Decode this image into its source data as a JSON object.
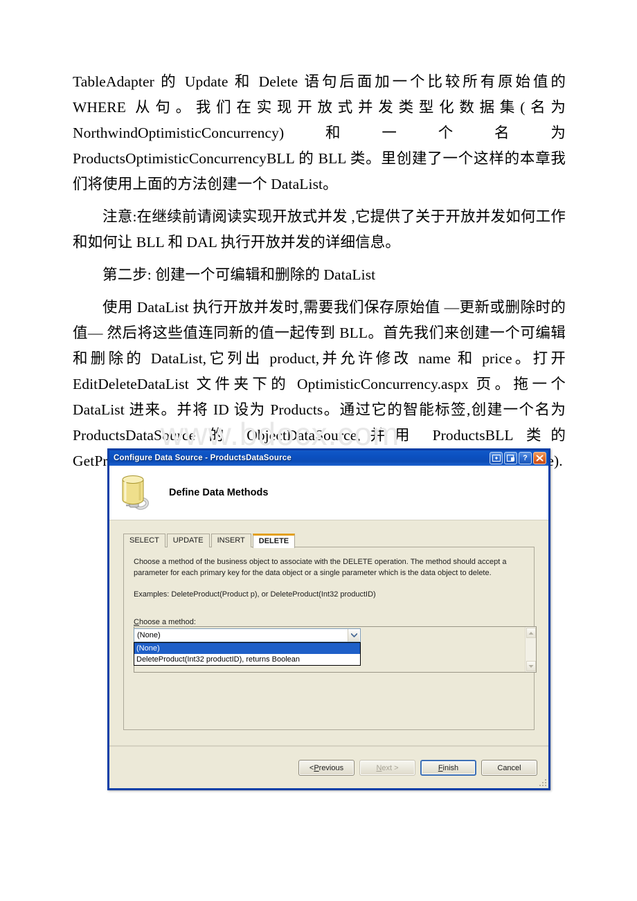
{
  "document": {
    "paragraphs": [
      "TableAdapter 的 Update 和 Delete 语句后面加一个比较所有原始值的 WHERE 从句。我们在实现开放式并发类型化数据集(名为 NorthwindOptimisticConcurrency)和一个名为 ProductsOptimisticConcurrencyBLL 的 BLL 类。里创建了一个这样的本章我们将使用上面的方法创建一个 DataList。",
      "注意:在继续前请阅读实现开放式并发 ,它提供了关于开放并发如何工作和如何让 BLL 和 DAL 执行开放并发的详细信息。",
      "第二步: 创建一个可编辑和删除的 DataList",
      "使用 DataList 执行开放并发时,需要我们保存原始值 —更新或删除时的值— 然后将这些值连同新的值一起传到 BLL。首先我们来创建一个可编辑和删除的 DataList,它列出 product,并允许修改 name 和 price。打开 EditDeleteDataList 文件夹下的 OptimisticConcurrency.aspx 页。拖一个 DataList 进来。并将 ID 设为 Products。通过它的智能标签,创建一个名为 ProductsDataSource 的 ObjectDataSource,并用 ProductsBLL 类的 GetProducts()方法配置它。在 UPDATE,INSERT,DELETE 标签里选择(None)."
    ],
    "watermark": "www.bdocx.com"
  },
  "dialog": {
    "title": "Configure Data Source - ProductsDataSource",
    "titlebar_buttons": [
      {
        "name": "restore-split-button",
        "glyph": "◂▸"
      },
      {
        "name": "maximize-button",
        "glyph": "❐"
      },
      {
        "name": "help-button",
        "glyph": "?"
      },
      {
        "name": "close-button",
        "glyph": "✕"
      }
    ],
    "header_title": "Define Data Methods",
    "icon": "database-plug-icon",
    "tabs": [
      {
        "label": "SELECT",
        "active": false
      },
      {
        "label": "UPDATE",
        "active": false
      },
      {
        "label": "INSERT",
        "active": false
      },
      {
        "label": "DELETE",
        "active": true
      }
    ],
    "panel": {
      "description": "Choose a method of the business object to associate with the DELETE operation. The method should accept a parameter for each primary key for the data object or a single parameter which is the data object to delete.",
      "examples": "Examples: DeleteProduct(Product p), or DeleteProduct(Int32 productID)",
      "choose_label_prefix": "C",
      "choose_label_rest": "hoose a method:",
      "combo_value": "(None)",
      "dropdown_options": [
        {
          "label": "(None)",
          "selected": true
        },
        {
          "label": "DeleteProduct(Int32 productID), returns Boolean",
          "selected": false
        }
      ]
    },
    "buttons": [
      {
        "name": "previous-button",
        "pre": "< ",
        "accel": "P",
        "post": "revious",
        "state": "enabled"
      },
      {
        "name": "next-button",
        "pre": "",
        "accel": "N",
        "post": "ext >",
        "state": "disabled"
      },
      {
        "name": "finish-button",
        "pre": "",
        "accel": "F",
        "post": "inish",
        "state": "default"
      },
      {
        "name": "cancel-button",
        "pre": "",
        "accel": "",
        "post": "Cancel",
        "state": "enabled"
      }
    ]
  },
  "colors": {
    "titlebar": "#0b50c0",
    "dialog_bg": "#ece9d8",
    "active_tab_accent": "#e3a01c",
    "selection": "#1e5fc8",
    "close_button": "#e2702a"
  }
}
